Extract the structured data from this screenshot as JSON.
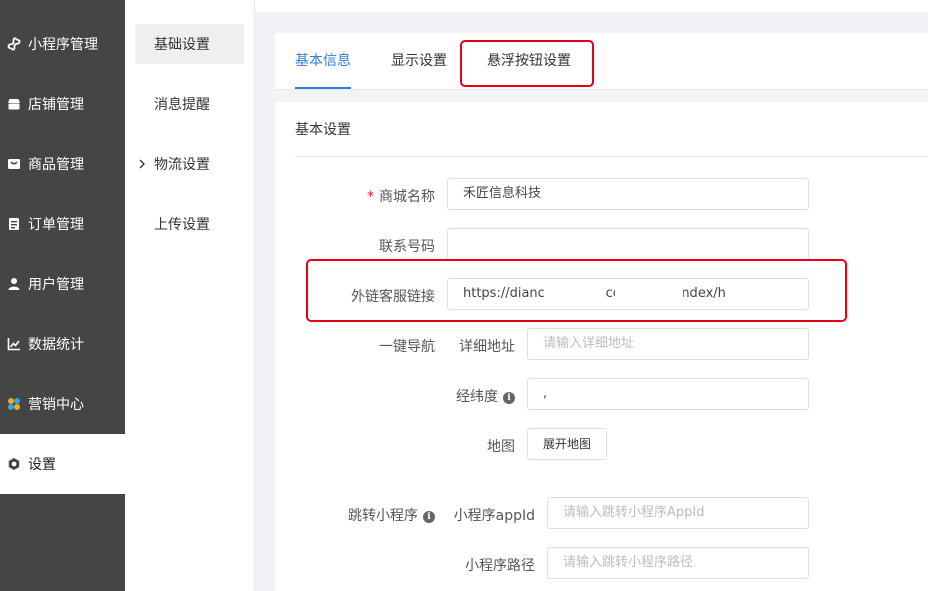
{
  "nav": {
    "items": [
      {
        "label": "小程序管理",
        "icon": "miniprogram-icon"
      },
      {
        "label": "店铺管理",
        "icon": "store-icon"
      },
      {
        "label": "商品管理",
        "icon": "goods-icon"
      },
      {
        "label": "订单管理",
        "icon": "order-icon"
      },
      {
        "label": "用户管理",
        "icon": "user-icon"
      },
      {
        "label": "数据统计",
        "icon": "chart-icon"
      },
      {
        "label": "营销中心",
        "icon": "marketing-icon"
      },
      {
        "label": "设置",
        "icon": "gear-icon"
      }
    ],
    "active_index": 7
  },
  "subnav": {
    "items": [
      {
        "label": "基础设置"
      },
      {
        "label": "消息提醒"
      },
      {
        "label": "物流设置"
      },
      {
        "label": "上传设置"
      }
    ],
    "active_index": 0
  },
  "tabs": [
    {
      "label": "基本信息"
    },
    {
      "label": "显示设置"
    },
    {
      "label": "悬浮按钮设置"
    }
  ],
  "section": {
    "title": "基本设置"
  },
  "form": {
    "shop_name": {
      "label": "商城名称",
      "required_mark": "*",
      "value": "禾匠信息科技"
    },
    "phone": {
      "label": "联系号码",
      "value": ""
    },
    "service_link": {
      "label": "外链客服链接",
      "value": "https://dianc          an·           iang.com/index/index/h"
    },
    "navigation": {
      "label": "一键导航",
      "address": {
        "label": "详细地址",
        "placeholder": "请输入详细地址"
      },
      "latlng": {
        "label": "经纬度",
        "value": ","
      },
      "map": {
        "label": "地图",
        "button": "展开地图"
      }
    },
    "jump_mini": {
      "label": "跳转小程序",
      "appid": {
        "label": "小程序appId",
        "placeholder": "请输入跳转小程序AppId"
      },
      "path": {
        "label": "小程序路径",
        "placeholder": "请输入跳转小程序路径"
      }
    }
  },
  "colors": {
    "accent": "#2f7de1",
    "nav_bg": "#454545",
    "highlight": "#e60012"
  }
}
